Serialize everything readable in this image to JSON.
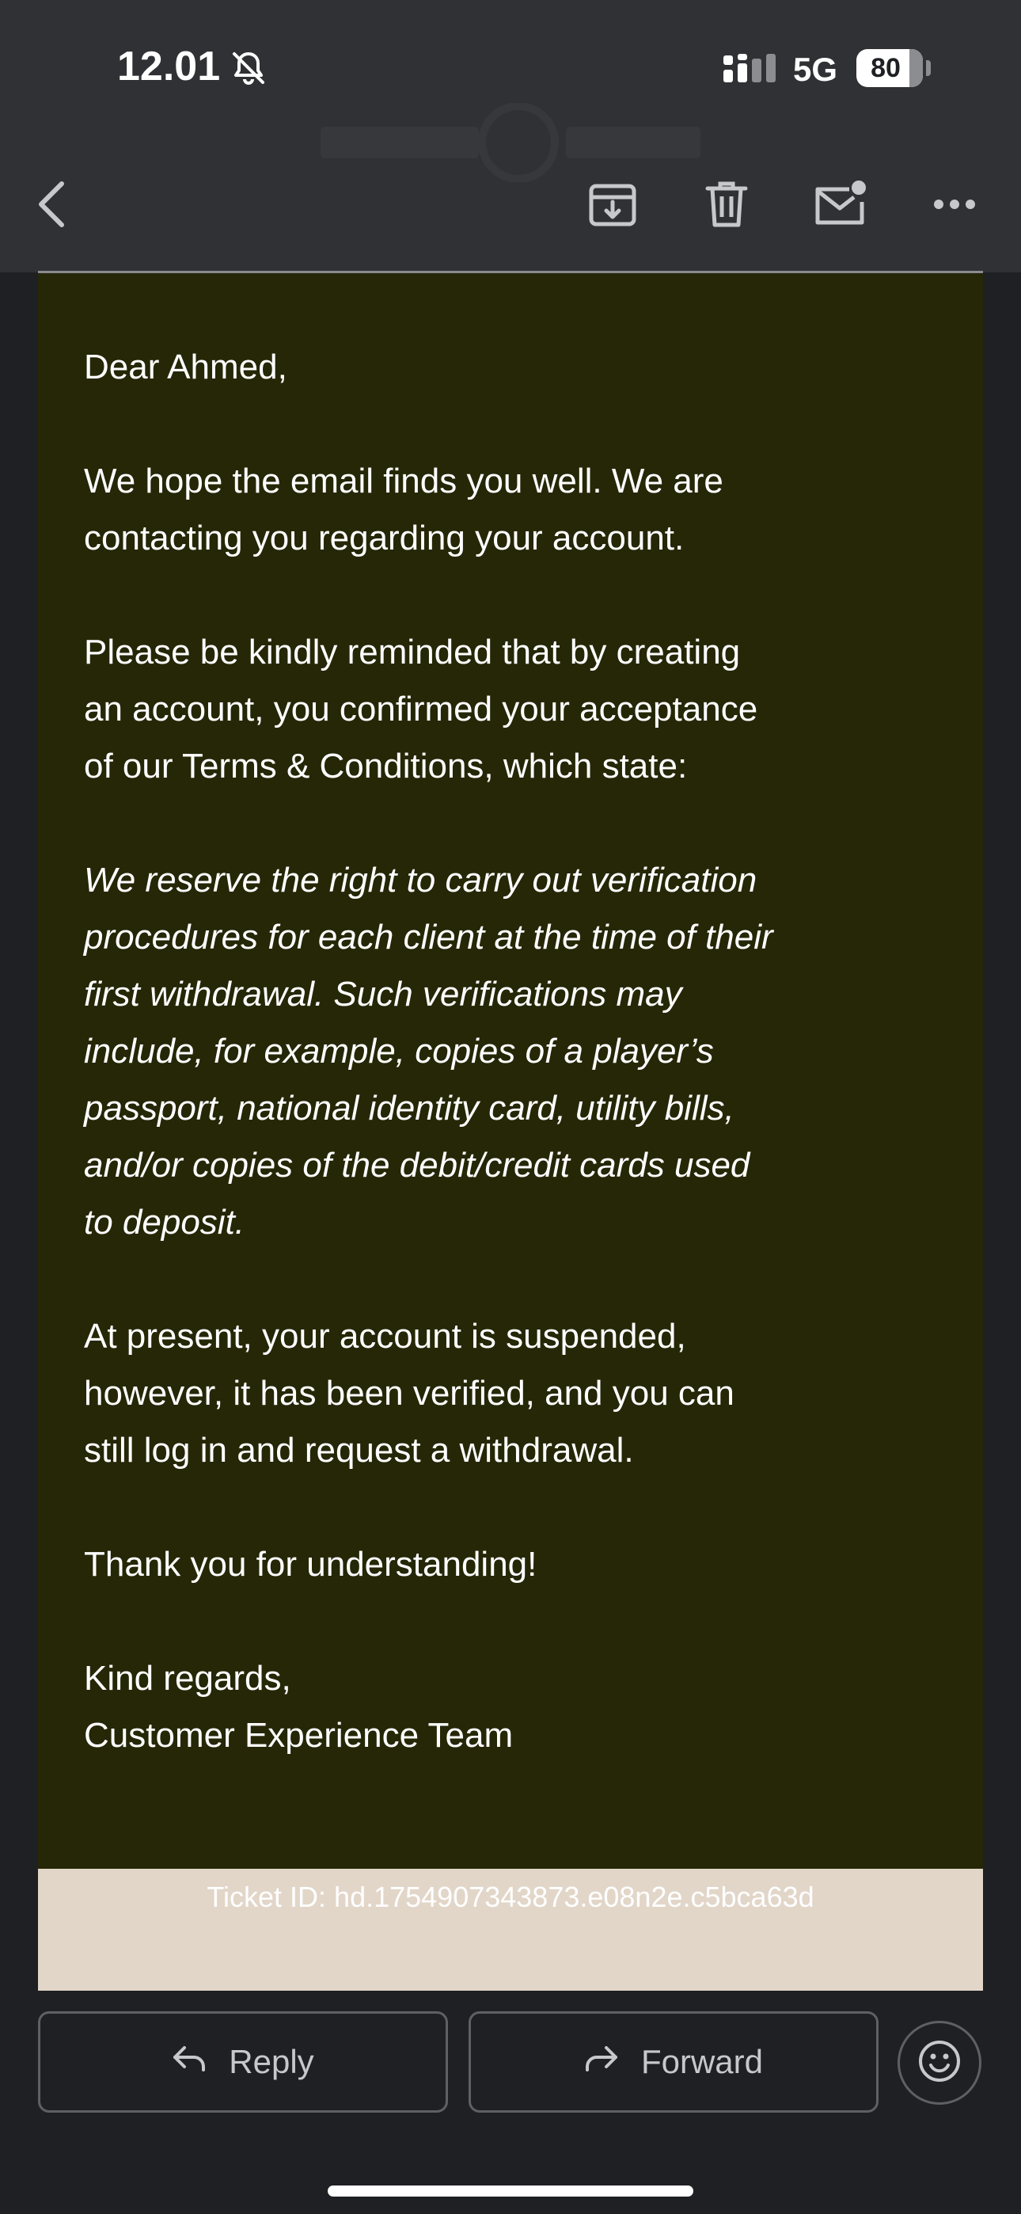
{
  "status_bar": {
    "time": "12.01",
    "network": "5G",
    "battery": "80",
    "battery_level": 0.8
  },
  "toolbar": {
    "back_icon": "chevron-left-icon",
    "archive_icon": "archive-icon",
    "delete_icon": "trash-icon",
    "mark_unread_icon": "mail-unread-icon",
    "more_icon": "more-horizontal-icon"
  },
  "email": {
    "greeting": "Dear Ahmed,",
    "paragraph_1": [
      "We hope the email finds you well. We are",
      "contacting you regarding your account."
    ],
    "paragraph_2": [
      "Please be kindly reminded that by creating",
      "an account, you confirmed your acceptance",
      "of our Terms & Conditions, which state:"
    ],
    "quote": [
      "We reserve the right to carry out verification",
      "procedures for each client at the time of their",
      "first withdrawal. Such verifications may",
      "include, for example, copies of a player’s",
      "passport, national identity card, utility bills,",
      "and/or copies of the debit/credit cards used",
      "to deposit."
    ],
    "paragraph_3": [
      "At present, your account is suspended,",
      "however, it has been verified, and you can",
      "still log in and request a withdrawal."
    ],
    "thanks": "Thank you for understanding!",
    "closing": "Kind regards,",
    "signature": "Customer Experience Team",
    "ticket_id": "Ticket ID: hd.1754907343873.e08n2e.c5bca63d"
  },
  "actions": {
    "reply_label": "Reply",
    "forward_label": "Forward",
    "emoji_icon": "smiley-icon"
  },
  "colors": {
    "chrome": "#303134",
    "background": "#1f2024",
    "email_background": "#262707",
    "ticket_strip": "#e2d6c9",
    "text": "#ffffff"
  }
}
